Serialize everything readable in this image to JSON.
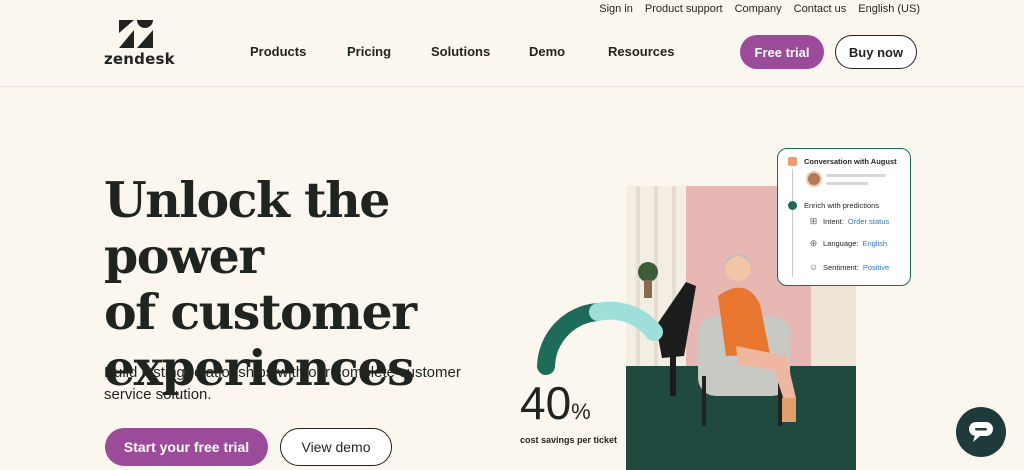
{
  "utility_nav": {
    "sign_in": "Sign in",
    "product_support": "Product support",
    "company": "Company",
    "contact_us": "Contact us",
    "language": "English (US)"
  },
  "logo": {
    "wordmark": "zendesk"
  },
  "nav": {
    "items": [
      "Products",
      "Pricing",
      "Solutions",
      "Demo",
      "Resources"
    ],
    "free_trial": "Free trial",
    "buy_now": "Buy now"
  },
  "hero": {
    "title_line1": "Unlock the power",
    "title_line2": "of customer",
    "title_line3": "experiences",
    "subtitle": "Build lasting relationships with our complete customer service solution.",
    "cta_primary": "Start your free trial",
    "cta_secondary": "View demo"
  },
  "stat": {
    "number": "40",
    "suffix": "%",
    "caption": "cost savings per ticket"
  },
  "conversation_card": {
    "title": "Conversation with August",
    "enrich": "Enrich with predictions",
    "intent_label": "Intent:",
    "intent_value": "Order status",
    "language_label": "Language:",
    "language_value": "English",
    "sentiment_label": "Sentiment:",
    "sentiment_value": "Positive"
  },
  "colors": {
    "brand_purple": "#9c4a9a",
    "background": "#fbf6ee",
    "accent_green": "#1f6b5a",
    "arc_light": "#9ee0d9",
    "chat_bg": "#1f3a3a"
  },
  "icons": {
    "intent": "grid-icon",
    "language": "globe-icon",
    "sentiment": "smiley-icon",
    "chat": "chat-bubble-icon"
  }
}
